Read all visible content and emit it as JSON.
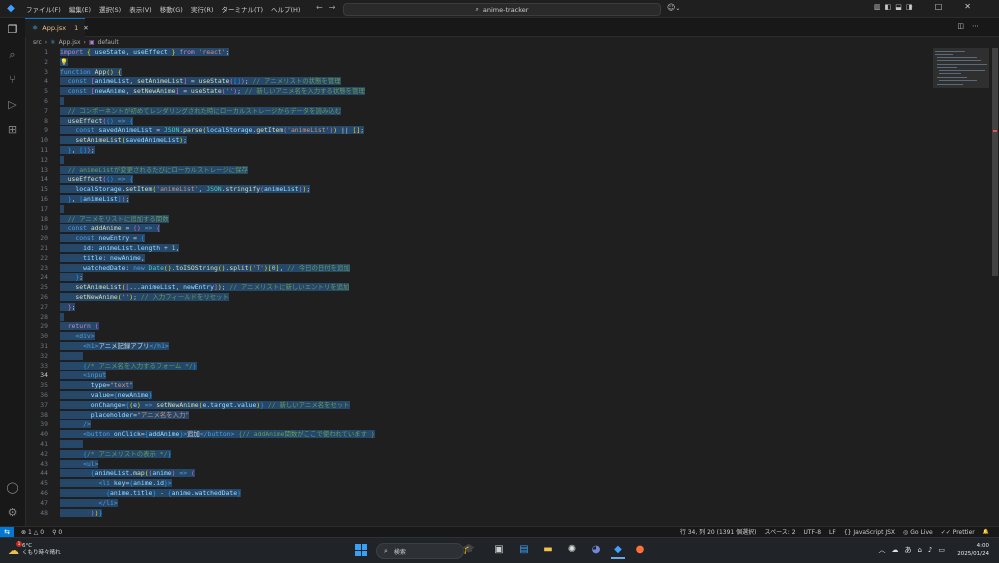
{
  "titlebar": {
    "menu": [
      "ファイル(F)",
      "編集(E)",
      "選択(S)",
      "表示(V)",
      "移動(G)",
      "実行(R)",
      "ターミナル(T)",
      "ヘルプ(H)"
    ],
    "nav_back": "←",
    "nav_forward": "→",
    "search_text": "anime-tracker",
    "copilot_label": "⌄",
    "window_minimize": "–",
    "window_maximize": "□",
    "window_close": "✕"
  },
  "tab": {
    "name": "App.jsx",
    "problems": "1",
    "close": "✕"
  },
  "breadcrumb": {
    "folder": "src",
    "file": "App.jsx",
    "symbol": "default"
  },
  "editor": {
    "current_line": 34
  },
  "statusbar": {
    "errors": "1",
    "warnings": "0",
    "ports": "0",
    "position": "行 34, 列 20 (1391 個選択)",
    "spaces": "スペース: 2",
    "encoding": "UTF-8",
    "eol": "LF",
    "language": "JavaScript JSX",
    "golive": "Go Live",
    "prettier": "Prettier",
    "bell": "🔔"
  },
  "taskbar": {
    "weather_temp": "6°C",
    "weather_desc": "くもり時々晴れ",
    "weather_badge": "1",
    "search_placeholder": "検索",
    "time": "4:00",
    "date": "2025/01/24",
    "ime": "あ"
  },
  "colors": {
    "accent": "#0078d4",
    "selection": "#264f78",
    "background": "#1f1f1f"
  }
}
